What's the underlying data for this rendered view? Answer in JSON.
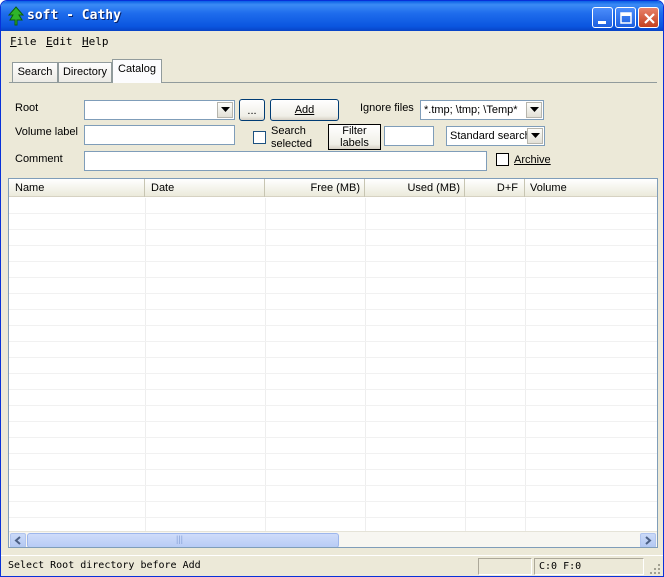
{
  "window": {
    "title": "soft - Cathy",
    "colors": {
      "titlebar": "#0a55df",
      "face": "#ece9d8",
      "border": "#7f9db9"
    }
  },
  "menu": [
    "File",
    "Edit",
    "Help"
  ],
  "tabs": [
    {
      "label": "Search",
      "active": false
    },
    {
      "label": "Directory",
      "active": false
    },
    {
      "label": "Catalog",
      "active": true
    }
  ],
  "form": {
    "root_label": "Root",
    "root_value": "",
    "browse_label": "...",
    "add_label": "Add",
    "ignore_label": "Ignore files",
    "ignore_value": "*.tmp; \\tmp; \\Temp*",
    "volume_label": "Volume label",
    "volume_value": "",
    "search_selected_line1": "Search",
    "search_selected_line2": "selected",
    "filter_line1": "Filter",
    "filter_line2": "labels",
    "filter_value": "",
    "search_mode": "Standard search",
    "comment_label": "Comment",
    "comment_value": "",
    "archive_label": "Archive"
  },
  "table": {
    "columns": [
      "Name",
      "Date",
      "Free (MB)",
      "Used (MB)",
      "D+F",
      "Volume"
    ],
    "rows": []
  },
  "scroll_glyph": "|||",
  "status": {
    "message": "Select Root directory before Add",
    "counts": "C:0 F:0"
  }
}
